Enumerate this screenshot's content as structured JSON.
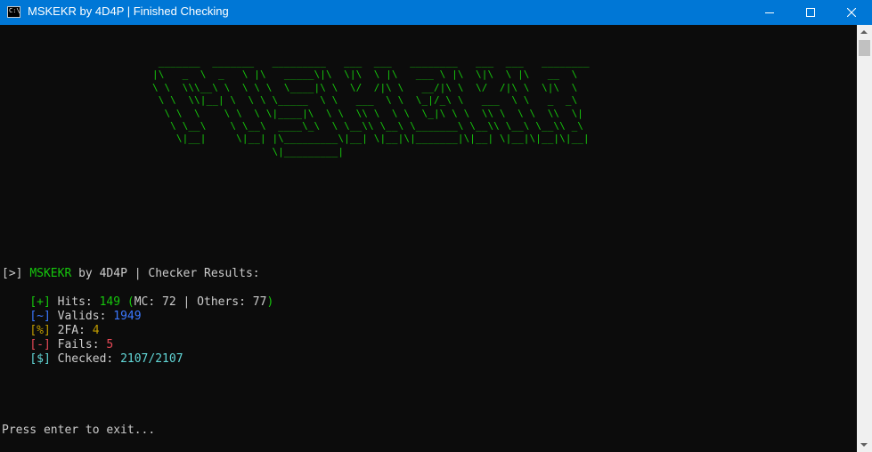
{
  "window": {
    "title": "MSKEKR by 4D4P | Finished Checking",
    "icon_text": "C:\\"
  },
  "banner": {
    "ascii": " _______  _______   _________   ___  ___   ________   ___  ___   ________\n|\\   _  \\  _   \\ |\\   _____\\|\\  \\|\\  \\ |\\   ___ \\ |\\  \\|\\  \\ |\\   __  \\\n\\ \\  \\\\\\__\\ \\  \\ \\ \\  \\____|\\ \\  \\/  /|\\ \\   __/|\\ \\  \\/  /|\\ \\  \\|\\  \\\n \\ \\  \\\\|__| \\  \\ \\ \\_____  \\ \\   ___  \\ \\  \\_|/_\\ \\   ___  \\ \\   _  _\\\n  \\ \\  \\    \\ \\  \\ \\|____|\\  \\ \\  \\\\ \\  \\ \\  \\_|\\ \\ \\  \\\\ \\  \\ \\  \\\\  \\|\n   \\ \\__\\    \\ \\__\\  ____\\_\\  \\ \\__\\\\ \\__\\ \\_______\\ \\__\\\\ \\__\\ \\__\\\\ _\\\n    \\|__|     \\|__| |\\_________\\|__| \\|__|\\|_______|\\|__| \\|__|\\|__|\\|__|\n                    \\|_________|"
  },
  "results": {
    "prompt_bracket": "[>]",
    "app_name": "MSKEKR",
    "by_text": " by 4D4P | Checker Results:",
    "hits": {
      "bracket": "[+]",
      "label": " Hits: ",
      "value": "149",
      "paren_open": " (",
      "detail": "MC: 72 | Others: 77",
      "paren_close": ")"
    },
    "valids": {
      "bracket": "[~]",
      "label": " Valids: ",
      "value": "1949"
    },
    "twofa": {
      "bracket": "[%]",
      "label": " 2FA: ",
      "value": "4"
    },
    "fails": {
      "bracket": "[-]",
      "label": " Fails: ",
      "value": "5"
    },
    "checked": {
      "bracket": "[$]",
      "label": " Checked: ",
      "value": "2107/2107"
    }
  },
  "footer": {
    "exit_prompt": "Press enter to exit..."
  },
  "colors": {
    "titlebar": "#0077d6",
    "console_bg": "#0c0c0c",
    "green": "#16c60c",
    "blue": "#3b78ff",
    "yellow": "#c19c00",
    "red": "#e74856",
    "gray": "#cccccc"
  }
}
